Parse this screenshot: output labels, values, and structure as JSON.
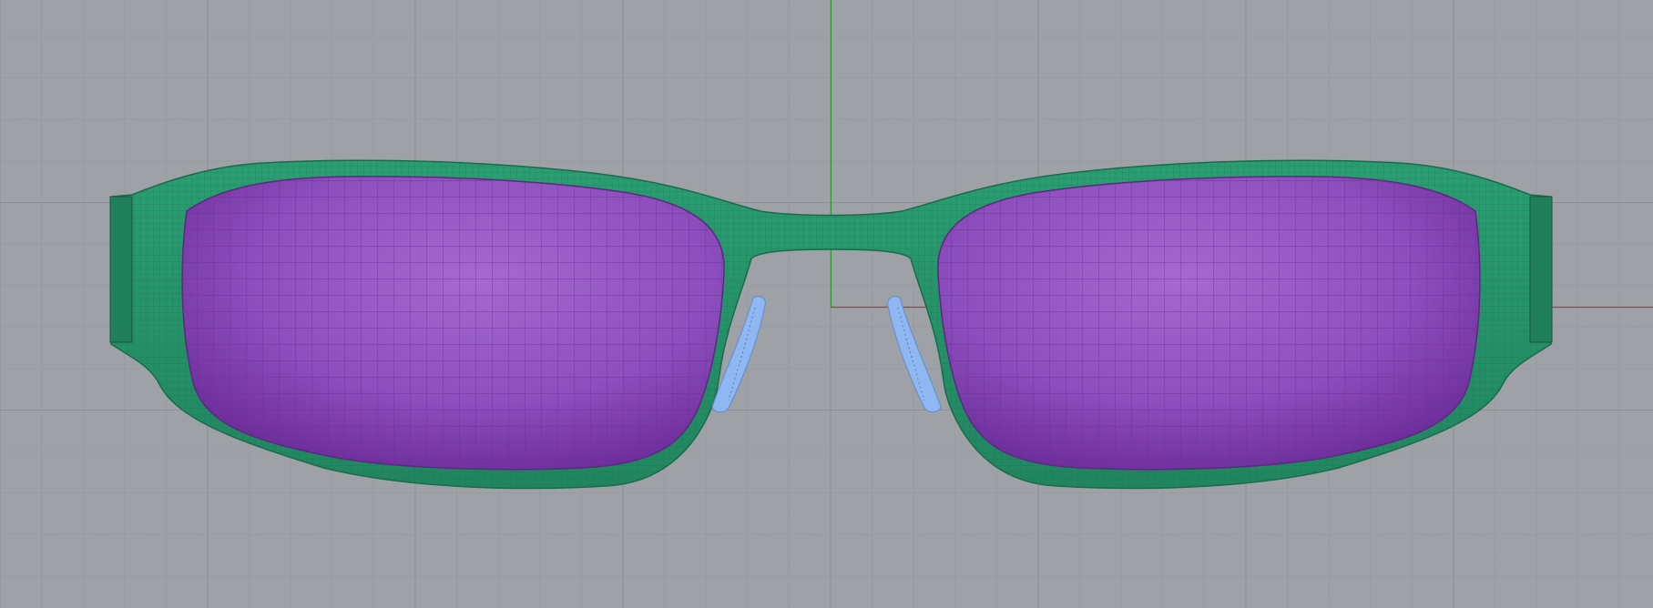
{
  "viewport": {
    "view": "Front",
    "grid": true,
    "background_color": "#9ea2a6"
  },
  "axes": {
    "x_axis_color": "#b23a32",
    "y_axis_color": "#2f9a35"
  },
  "model": {
    "frame": {
      "color": "#26936a"
    },
    "lenses": {
      "color": "#9a55c2"
    },
    "nose_pads": {
      "color": "#8fb8f2"
    }
  }
}
